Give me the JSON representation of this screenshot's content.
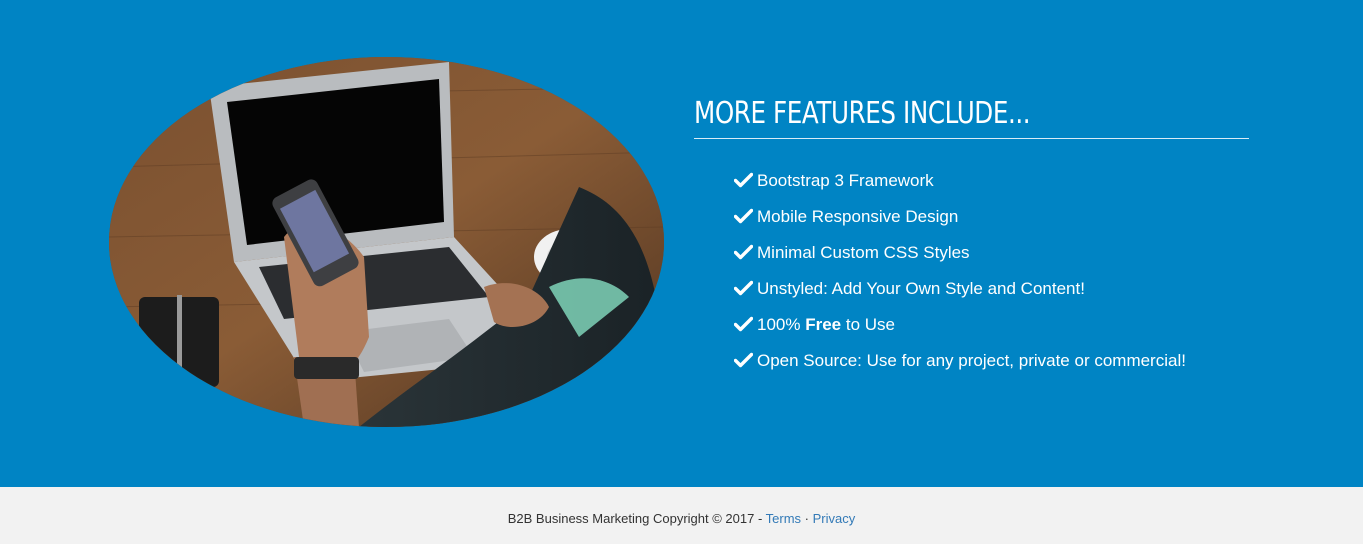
{
  "features": {
    "heading": "MORE FEATURES INCLUDE...",
    "items": [
      {
        "pre": "Bootstrap 3 Framework",
        "bold": "",
        "post": ""
      },
      {
        "pre": "Mobile Responsive Design",
        "bold": "",
        "post": ""
      },
      {
        "pre": "Minimal Custom CSS Styles",
        "bold": "",
        "post": ""
      },
      {
        "pre": "Unstyled: Add Your Own Style and Content!",
        "bold": "",
        "post": ""
      },
      {
        "pre": "100% ",
        "bold": "Free",
        "post": " to Use"
      },
      {
        "pre": "Open Source: Use for any project, private or commercial!",
        "bold": "",
        "post": ""
      }
    ],
    "icon": "checkmark-icon"
  },
  "image": {
    "icon": "laptop-phone-photo"
  },
  "footer": {
    "copyright": "B2B Business Marketing Copyright © 2017 - ",
    "terms_label": "Terms",
    "separator": " · ",
    "privacy_label": "Privacy"
  },
  "colors": {
    "section_bg": "#0084c4",
    "footer_bg": "#f2f2f2",
    "link": "#337ab7",
    "text_white": "#ffffff"
  }
}
